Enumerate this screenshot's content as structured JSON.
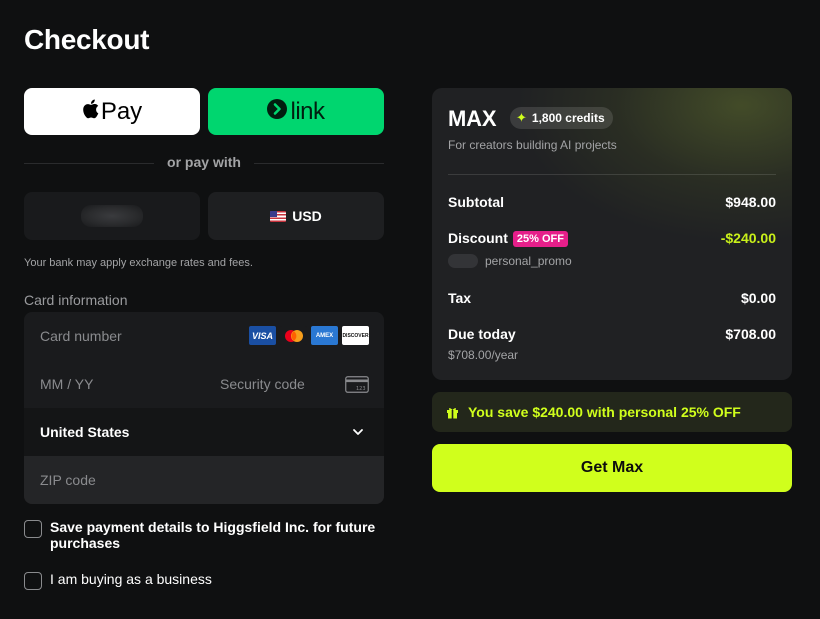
{
  "page": {
    "title": "Checkout"
  },
  "wallets": {
    "apple_pay_label": "Pay",
    "link_label": "link",
    "divider_text": "or pay with"
  },
  "currency": {
    "usd_label": "USD",
    "bank_note": "Your bank may apply exchange rates and fees."
  },
  "card": {
    "section_label": "Card information",
    "number_placeholder": "Card number",
    "expiry_placeholder": "MM / YY",
    "security_placeholder": "Security code",
    "country_value": "United States",
    "zip_placeholder": "ZIP code",
    "brands": [
      "VISA",
      "mastercard",
      "AMEX",
      "DISCOVER"
    ]
  },
  "options": {
    "save_details": "Save payment details to Higgsfield Inc. for future purchases",
    "business": "I am buying as a business"
  },
  "summary": {
    "plan_name": "MAX",
    "credits": "1,800 credits",
    "plan_description": "For creators building AI projects",
    "subtotal_label": "Subtotal",
    "subtotal_amount": "$948.00",
    "discount_label": "Discount",
    "discount_badge": "25% OFF",
    "discount_amount": "-$240.00",
    "promo_code": "personal_promo",
    "tax_label": "Tax",
    "tax_amount": "$0.00",
    "due_label": "Due today",
    "due_amount": "$708.00",
    "due_sub": "$708.00/year"
  },
  "savings_text": "You save $240.00 with personal 25% OFF",
  "cta_label": "Get Max",
  "colors": {
    "background": "#0f1011",
    "link_green": "#00d66f",
    "accent_lime": "#d0ff1c",
    "discount_pink": "#e61f8a"
  }
}
